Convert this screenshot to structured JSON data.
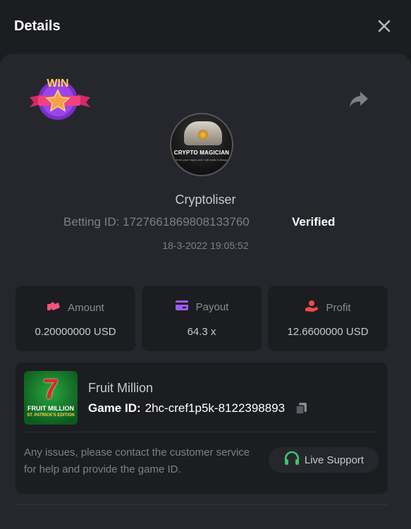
{
  "header": {
    "title": "Details",
    "close_icon": "close-icon"
  },
  "bet": {
    "badge_text": "WIN",
    "username": "Cryptoliser",
    "betting_id_label": "Betting ID:",
    "betting_id": "1727661869808133760",
    "verified": "Verified",
    "timestamp": "18-3-2022 19:05:52",
    "avatar": {
      "brand": "CRYPTO MAGICIAN",
      "tagline": "send me your crypto and i will make it disappear"
    }
  },
  "stats": [
    {
      "label": "Amount",
      "value": "0.20000000 USD",
      "icon": "amount-icon",
      "color": "#f2557a"
    },
    {
      "label": "Payout",
      "value": "64.3 x",
      "icon": "payout-card-icon",
      "color": "#9b5cf6"
    },
    {
      "label": "Profit",
      "value": "12.6600000 USD",
      "icon": "profit-hand-icon",
      "color": "#f04a4a"
    }
  ],
  "game": {
    "name": "Fruit Million",
    "id_label": "Game ID:",
    "id": "2hc-cref1p5k-8122398893",
    "thumb": {
      "seven": "7",
      "title": "FRUIT MILLION",
      "subtitle": "ST. PATRICK'S EDITION"
    },
    "support_text": "Any issues, please contact the customer service for help and provide the game ID.",
    "live_support": "Live Support"
  },
  "colors": {
    "accent_green": "#3ec46d",
    "background": "#1a1b1f",
    "panel": "#26272c",
    "card": "#1c1d21"
  }
}
